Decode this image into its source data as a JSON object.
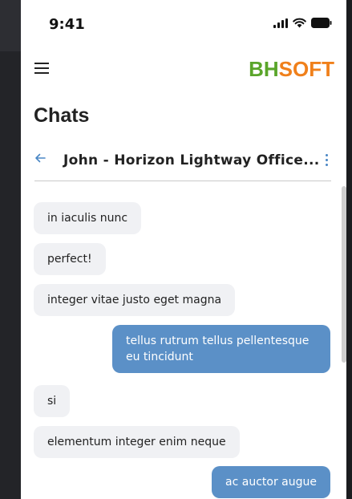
{
  "status": {
    "time": "9:41"
  },
  "header": {
    "logo_part1": "BH",
    "logo_part2": "SOFT"
  },
  "page": {
    "title": "Chats"
  },
  "chat": {
    "title": "John  -  Horizon Lightway Office..."
  },
  "messages": [
    {
      "text": "in iaculis nunc",
      "dir": "in"
    },
    {
      "text": "perfect!",
      "dir": "in"
    },
    {
      "text": "integer vitae justo eget magna",
      "dir": "in"
    },
    {
      "text": "tellus rutrum tellus pellentesque eu tincidunt",
      "dir": "out"
    },
    {
      "text": "si",
      "dir": "in"
    },
    {
      "text": "elementum integer enim neque",
      "dir": "in"
    },
    {
      "text": "ac auctor augue",
      "dir": "out"
    }
  ]
}
